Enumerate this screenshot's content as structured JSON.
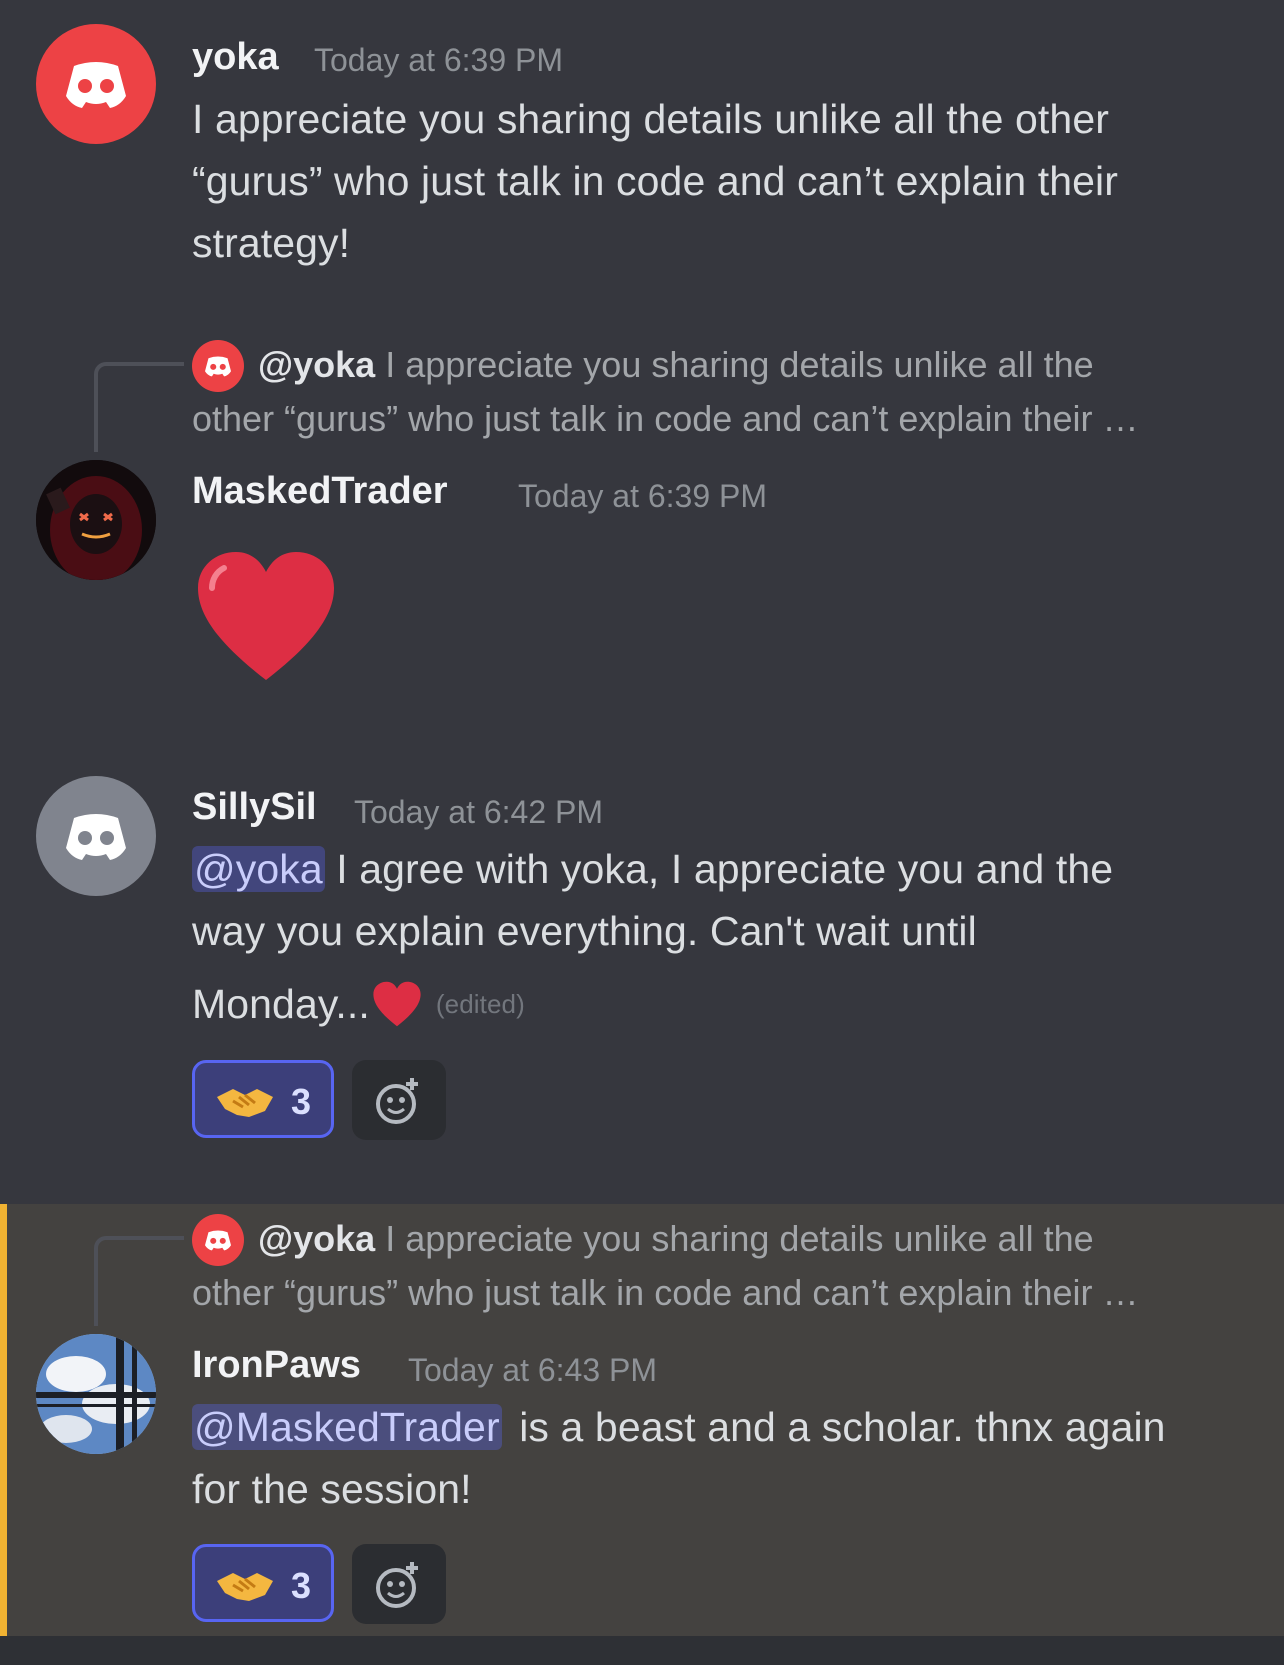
{
  "messages": [
    {
      "author": "yoka",
      "timestamp": "Today at 6:39 PM",
      "lines": [
        "I appreciate you sharing details unlike all the other",
        "“gurus” who just talk in code and can’t explain their",
        "strategy!"
      ],
      "avatar_color": "#ed4245"
    },
    {
      "author": "MaskedTrader",
      "timestamp": "Today at 6:39 PM",
      "reply": {
        "mention": "@yoka",
        "line1": "I appreciate you sharing details unlike all the",
        "line2": "other “gurus” who just talk in code and can’t explain their …"
      },
      "content_emoji": "heart-emoji"
    },
    {
      "author": "SillySil",
      "timestamp": "Today at 6:42 PM",
      "mention": "@yoka",
      "line1_rest": "I agree with yoka, I appreciate you and the",
      "line2": "way you explain everything. Can't wait until",
      "line3": "Monday...",
      "edited": "(edited)",
      "reaction_count": "3",
      "avatar_color": "#80848e"
    },
    {
      "author": "IronPaws",
      "timestamp": "Today at 6:43 PM",
      "reply": {
        "mention": "@yoka",
        "line1": "I appreciate you sharing details unlike all the",
        "line2": "other “gurus” who just talk in code and can’t explain their …"
      },
      "mention": "@MaskedTrader",
      "line1_rest": "is a beast and a scholar. thnx again",
      "line2": "for the session!",
      "reaction_count": "3",
      "highlight_color": "#f0b232"
    }
  ],
  "colors": {
    "background": "#36373e",
    "accent": "#5865f2",
    "mention_bg": "rgba(88,101,242,0.35)"
  }
}
